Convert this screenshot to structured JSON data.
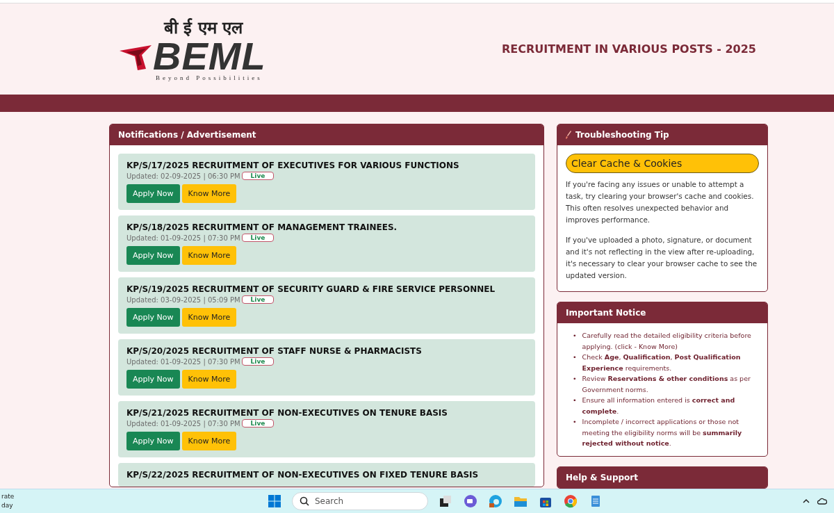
{
  "header": {
    "logo": {
      "hindi": "बी ई एम एल",
      "wordmark": "BEML",
      "tagline": "Beyond Possibilities"
    },
    "title": "RECRUITMENT IN VARIOUS POSTS - 2025"
  },
  "notifications": {
    "title": "Notifications / Advertisement",
    "items": [
      {
        "title": "KP/S/17/2025 RECRUITMENT OF EXECUTIVES FOR VARIOUS FUNCTIONS",
        "updated": "Updated: 02-09-2025 | 06:30 PM",
        "badge": "Live",
        "buttons": [
          "Apply Now",
          "Know More"
        ]
      },
      {
        "title": "KP/S/18/2025 RECRUITMENT OF MANAGEMENT TRAINEES.",
        "updated": "Updated: 01-09-2025 | 07:30 PM",
        "badge": "Live",
        "buttons": [
          "Apply Now",
          "Know More"
        ]
      },
      {
        "title": "KP/S/19/2025 RECRUITMENT OF SECURITY GUARD & FIRE SERVICE PERSONNEL",
        "updated": "Updated: 03-09-2025 | 05:09 PM",
        "badge": "Live",
        "buttons": [
          "Apply Now",
          "Know More"
        ]
      },
      {
        "title": "KP/S/20/2025 RECRUITMENT OF STAFF NURSE & PHARMACISTS",
        "updated": "Updated: 01-09-2025 | 07:30 PM",
        "badge": "Live",
        "buttons": [
          "Apply Now",
          "Know More"
        ]
      },
      {
        "title": "KP/S/21/2025 RECRUITMENT OF NON-EXECUTIVES ON TENURE BASIS",
        "updated": "Updated: 01-09-2025 | 07:30 PM",
        "badge": "Live",
        "buttons": [
          "Apply Now",
          "Know More"
        ]
      },
      {
        "title": "KP/S/22/2025 RECRUITMENT OF NON-EXECUTIVES ON FIXED TENURE BASIS"
      }
    ]
  },
  "tip": {
    "title": "Troubleshooting Tip",
    "button": "Clear Cache & Cookies",
    "paragraphs": [
      "If you're facing any issues or unable to attempt a task, try clearing your browser's cache and cookies. This often resolves unexpected behavior and improves performance.",
      "If you've uploaded a photo, signature, or document and it's not reflecting in the view after re-uploading, it's necessary to clear your browser cache to see the updated version."
    ]
  },
  "notice": {
    "title": "Important Notice",
    "items": [
      {
        "marker": "•",
        "text": "Carefully read the detailed eligibility criteria before applying. (click - Know More)"
      },
      {
        "marker": "•",
        "text": "Check **Age**, **Qualification**, **Post Qualification Experience** requirements."
      },
      {
        "marker": "•",
        "text": "Review **Reservations & other conditions** as per Government norms."
      },
      {
        "marker": "•",
        "text": "Ensure all information entered is **correct and complete**."
      },
      {
        "marker": "•",
        "text": "Incomplete / incorrect applications or those not meeting the eligibility norms will be **summarily rejected without notice**."
      }
    ]
  },
  "help": {
    "title": "Help & Support"
  },
  "taskbar": {
    "weather": [
      "rate",
      "day"
    ],
    "search": {
      "placeholder": "Search"
    }
  }
}
